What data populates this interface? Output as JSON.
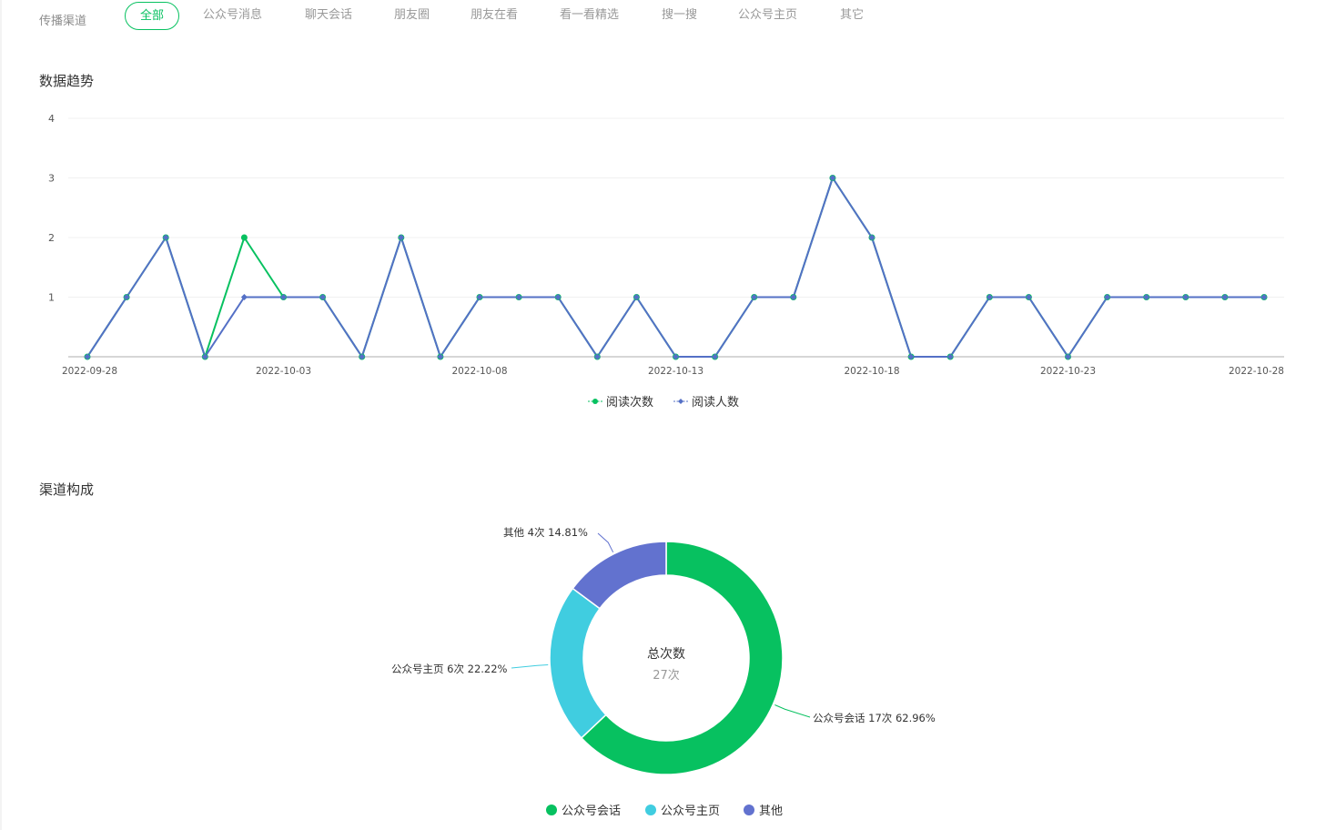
{
  "filter": {
    "label": "传播渠道",
    "tabs": [
      {
        "label": "全部",
        "active": true
      },
      {
        "label": "公众号消息"
      },
      {
        "label": "聊天会话"
      },
      {
        "label": "朋友圈"
      },
      {
        "label": "朋友在看"
      },
      {
        "label": "看一看精选"
      },
      {
        "label": "搜一搜"
      },
      {
        "label": "公众号主页"
      },
      {
        "label": "其它"
      }
    ]
  },
  "trend": {
    "title": "数据趋势",
    "chart_data": {
      "type": "line",
      "x_tick_labels": [
        "2022-09-28",
        "2022-10-03",
        "2022-10-08",
        "2022-10-13",
        "2022-10-18",
        "2022-10-23",
        "2022-10-28"
      ],
      "y_ticks": [
        1,
        2,
        3,
        4
      ],
      "ylim": [
        0,
        4
      ],
      "x": [
        "2022-09-28",
        "2022-09-29",
        "2022-09-30",
        "2022-10-01",
        "2022-10-02",
        "2022-10-03",
        "2022-10-04",
        "2022-10-05",
        "2022-10-06",
        "2022-10-07",
        "2022-10-08",
        "2022-10-09",
        "2022-10-10",
        "2022-10-11",
        "2022-10-12",
        "2022-10-13",
        "2022-10-14",
        "2022-10-15",
        "2022-10-16",
        "2022-10-17",
        "2022-10-18",
        "2022-10-19",
        "2022-10-20",
        "2022-10-21",
        "2022-10-22",
        "2022-10-23",
        "2022-10-24",
        "2022-10-25",
        "2022-10-26",
        "2022-10-27",
        "2022-10-28"
      ],
      "series": [
        {
          "name": "阅读次数",
          "color": "#07c160",
          "marker": "circle",
          "values": [
            0,
            1,
            2,
            0,
            2,
            1,
            1,
            0,
            2,
            0,
            1,
            1,
            1,
            0,
            1,
            0,
            0,
            1,
            1,
            3,
            2,
            0,
            0,
            1,
            1,
            0,
            1,
            1,
            1,
            1,
            1
          ]
        },
        {
          "name": "阅读人数",
          "color": "#5470c6",
          "marker": "diamond",
          "values": [
            0,
            1,
            2,
            0,
            1,
            1,
            1,
            0,
            2,
            0,
            1,
            1,
            1,
            0,
            1,
            0,
            0,
            1,
            1,
            3,
            2,
            0,
            0,
            1,
            1,
            0,
            1,
            1,
            1,
            1,
            1
          ]
        }
      ],
      "legend": "bottom-center",
      "grid": true
    }
  },
  "composition": {
    "title": "渠道构成",
    "center_title": "总次数",
    "center_value": "27次",
    "chart_data": {
      "type": "pie",
      "donut": true,
      "slices": [
        {
          "name": "公众号会话",
          "value": 17,
          "percent": "62.96%",
          "label": "公众号会话 17次 62.96%",
          "color": "#07c160"
        },
        {
          "name": "公众号主页",
          "value": 6,
          "percent": "22.22%",
          "label": "公众号主页 6次 22.22%",
          "color": "#40cde0"
        },
        {
          "name": "其他",
          "value": 4,
          "percent": "14.81%",
          "label": "其他 4次 14.81%",
          "color": "#6272cf"
        }
      ],
      "legend": "bottom-center"
    }
  }
}
